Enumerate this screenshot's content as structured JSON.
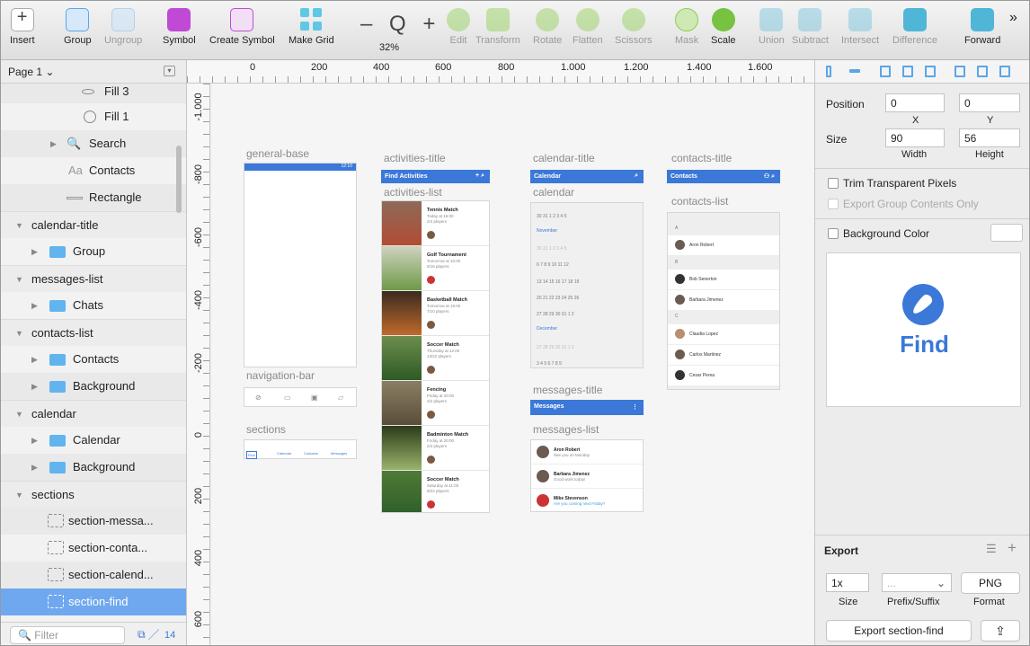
{
  "toolbar": {
    "insert": "Insert",
    "group": "Group",
    "ungroup": "Ungroup",
    "symbol": "Symbol",
    "create_symbol": "Create Symbol",
    "make_grid": "Make Grid",
    "zoom_value": "32%",
    "zoom_glyphs": "– Q +",
    "edit": "Edit",
    "transform": "Transform",
    "rotate": "Rotate",
    "flatten": "Flatten",
    "scissors": "Scissors",
    "mask": "Mask",
    "scale": "Scale",
    "union": "Union",
    "subtract": "Subtract",
    "intersect": "Intersect",
    "difference": "Difference",
    "forward": "Forward",
    "more": "»"
  },
  "layers": {
    "page": "Page 1 ⌄",
    "items": [
      {
        "label": "Fill 3"
      },
      {
        "label": "Fill 1"
      },
      {
        "label": "Search"
      },
      {
        "label": "Contacts"
      },
      {
        "label": "Rectangle"
      },
      {
        "label": "calendar-title"
      },
      {
        "label": "Group"
      },
      {
        "label": "messages-list"
      },
      {
        "label": "Chats"
      },
      {
        "label": "contacts-list"
      },
      {
        "label": "Contacts"
      },
      {
        "label": "Background"
      },
      {
        "label": "calendar"
      },
      {
        "label": "Calendar"
      },
      {
        "label": "Background"
      },
      {
        "label": "sections"
      },
      {
        "label": "section-messa..."
      },
      {
        "label": "section-conta..."
      },
      {
        "label": "section-calend..."
      },
      {
        "label": "section-find"
      }
    ],
    "filter_placeholder": "Filter",
    "count": "14",
    "text_prefix": "Aa"
  },
  "rulers": {
    "h": [
      "0",
      "200",
      "400",
      "600",
      "800",
      "1.000",
      "1.200",
      "1.400",
      "1.600"
    ],
    "v": [
      "-1.000",
      "-800",
      "-600",
      "-400",
      "-200",
      "0",
      "200",
      "400",
      "600"
    ]
  },
  "canvas": {
    "labels": {
      "general_base": "general-base",
      "navigation_bar": "navigation-bar",
      "sections": "sections",
      "activities_title": "activities-title",
      "activities_list": "activities-list",
      "calendar_title": "calendar-title",
      "calendar": "calendar",
      "messages_title": "messages-title",
      "messages_list": "messages-list",
      "contacts_title": "contacts-title",
      "contacts_list": "contacts-list"
    },
    "status_time": "12:10",
    "bars": {
      "find": "Find Activities",
      "calendar": "Calendar",
      "contacts": "Contacts",
      "messages": "Messages"
    },
    "section_tabs": [
      "Find",
      "Calendar",
      "Contacts",
      "Messages"
    ],
    "activities": [
      {
        "title": "Tennis Match",
        "line1": "Today at 16:00",
        "line2": "2/4 players"
      },
      {
        "title": "Golf Tournament",
        "line1": "Tomorrow at 10:00",
        "line2": "5/16 players"
      },
      {
        "title": "Basketball Match",
        "line1": "Tomorrow at 16:00",
        "line2": "7/10 players"
      },
      {
        "title": "Soccer Match",
        "line1": "Thursday at 12:00",
        "line2": "13/22 players"
      },
      {
        "title": "Fencing",
        "line1": "Friday at 20:00",
        "line2": "2/2 players"
      },
      {
        "title": "Badminton Match",
        "line1": "Friday at 20:00",
        "line2": "2/4 players"
      },
      {
        "title": "Soccer Match",
        "line1": "Saturday at 11:00",
        "line2": "8/22 players"
      }
    ],
    "calendar_rows": [
      "30  31   1   2   3   4   5",
      "November",
      "30  31   1   2   3   4   5",
      "6   7   8   9  10  11  12",
      "13  14  15  16  17  18  19",
      "20  21  22  23  24  25  26",
      "27  28  29  30  31   1   2",
      "December",
      "27  28  29  30  31   1   2",
      "3   4   5   6   7   8   9"
    ],
    "contacts": [
      {
        "letter": "A",
        "name": "Aron Robert"
      },
      {
        "letter": "B",
        "name": "Bob Senerton"
      },
      {
        "letter": "",
        "name": "Barbara Jimenez"
      },
      {
        "letter": "C",
        "name": "Claudia Lopez"
      },
      {
        "letter": "",
        "name": "Carlos Martinez"
      },
      {
        "letter": "",
        "name": "Cesar Perea"
      }
    ],
    "messages": [
      {
        "name": "Aron Robert",
        "text": "See you on Monday"
      },
      {
        "name": "Barbara Jimenez",
        "text": "Good work today!"
      },
      {
        "name": "Mike Stevenson",
        "text": "Are you coming next Friday?"
      }
    ]
  },
  "inspector": {
    "position_label": "Position",
    "pos_x": "0",
    "pos_y": "0",
    "x_label": "X",
    "y_label": "Y",
    "size_label": "Size",
    "width": "90",
    "height": "56",
    "width_label": "Width",
    "height_label": "Height",
    "trim": "Trim Transparent Pixels",
    "export_group": "Export Group Contents Only",
    "bg_color": "Background Color",
    "preview_text": "Find",
    "export_title": "Export",
    "scale": "1x",
    "prefix": "...",
    "format": "PNG",
    "size_sub": "Size",
    "prefix_sub": "Prefix/Suffix",
    "format_sub": "Format",
    "export_button": "Export section-find"
  },
  "colors": {
    "accent": "#3b78d8",
    "selection": "#6fa8ef"
  }
}
